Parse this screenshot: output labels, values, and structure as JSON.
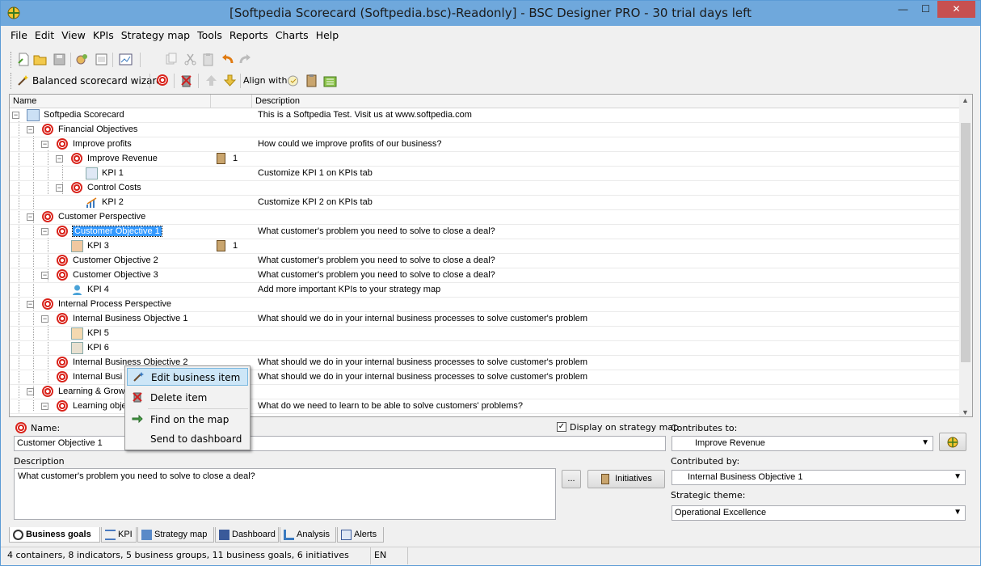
{
  "window": {
    "title": "[Softpedia Scorecard (Softpedia.bsc)-Readonly] - BSC Designer PRO - 30 trial days left",
    "minimize": "—",
    "maximize": "☐",
    "close": "✕"
  },
  "menu": [
    "File",
    "Edit",
    "View",
    "KPIs",
    "Strategy map",
    "Tools",
    "Reports",
    "Charts",
    "Help"
  ],
  "toolbar2": {
    "wizard_label": "Balanced scorecard wizard",
    "align_label": "Align with:"
  },
  "tree": {
    "columns": [
      "Name",
      "",
      "Description"
    ],
    "rows": [
      {
        "name": "Softpedia Scorecard",
        "desc": "This is a Softpedia Test. Visit us at www.softpedia.com",
        "count": ""
      },
      {
        "name": "Financial Objectives",
        "desc": "",
        "count": ""
      },
      {
        "name": "Improve profits",
        "desc": "How could we improve profits of our business?",
        "count": ""
      },
      {
        "name": "Improve Revenue",
        "desc": "",
        "count": "1"
      },
      {
        "name": "KPI 1",
        "desc": "Customize KPI 1 on KPIs tab",
        "count": ""
      },
      {
        "name": "Control Costs",
        "desc": "",
        "count": ""
      },
      {
        "name": "KPI 2",
        "desc": "Customize KPI 2 on KPIs tab",
        "count": ""
      },
      {
        "name": "Customer Perspective",
        "desc": "",
        "count": ""
      },
      {
        "name": "Customer Objective 1",
        "desc": "What customer's problem you need to solve to close a deal?",
        "count": ""
      },
      {
        "name": "KPI 3",
        "desc": "",
        "count": "1"
      },
      {
        "name": "Customer Objective 2",
        "desc": "What customer's problem you need to solve to close a deal?",
        "count": ""
      },
      {
        "name": "Customer Objective 3",
        "desc": "What customer's problem you need to solve to close a deal?",
        "count": ""
      },
      {
        "name": "KPI 4",
        "desc": "Add more important KPIs to your strategy map",
        "count": ""
      },
      {
        "name": "Internal Process Perspective",
        "desc": "",
        "count": ""
      },
      {
        "name": "Internal Business Objective 1",
        "desc": "What should we do in your internal business processes to solve customer's problem",
        "count": ""
      },
      {
        "name": "KPI 5",
        "desc": "",
        "count": ""
      },
      {
        "name": "KPI 6",
        "desc": "",
        "count": ""
      },
      {
        "name": "Internal Business Objective 2",
        "desc": "What should we do in your internal business processes to solve customer's problem",
        "count": ""
      },
      {
        "name": "Internal Busi",
        "desc": "What should we do in your internal business processes to solve customer's problem",
        "count": ""
      },
      {
        "name": "Learning & Growt",
        "desc": "",
        "count": ""
      },
      {
        "name": "Learning obje",
        "desc": "What do we need to learn to be able to solve customers' problems?",
        "count": ""
      }
    ]
  },
  "context_menu": [
    "Edit business item",
    "Delete item",
    "Find on the map",
    "Send to dashboard"
  ],
  "form": {
    "name_label": "Name:",
    "name_value": "Customer Objective 1",
    "display_on_map_label": "Display on strategy map",
    "display_on_map_checked": "✓",
    "contributes_to_label": "Contributes to:",
    "contributes_to_value": "Improve Revenue",
    "description_label": "Description",
    "description_value": "What customer's problem you need to solve to close a deal?",
    "ellipsis_button": "...",
    "initiatives_button": "Initiatives",
    "contributed_by_label": "Contributed by:",
    "contributed_by_value": "Internal Business Objective 1",
    "strategic_theme_label": "Strategic theme:",
    "strategic_theme_value": "Operational Excellence"
  },
  "tabs": [
    "Business goals",
    "KPI",
    "Strategy map",
    "Dashboard",
    "Analysis",
    "Alerts"
  ],
  "status": {
    "summary": "4 containers, 8 indicators, 5 business groups, 11 business goals, 6 initiatives",
    "lang": "EN"
  }
}
